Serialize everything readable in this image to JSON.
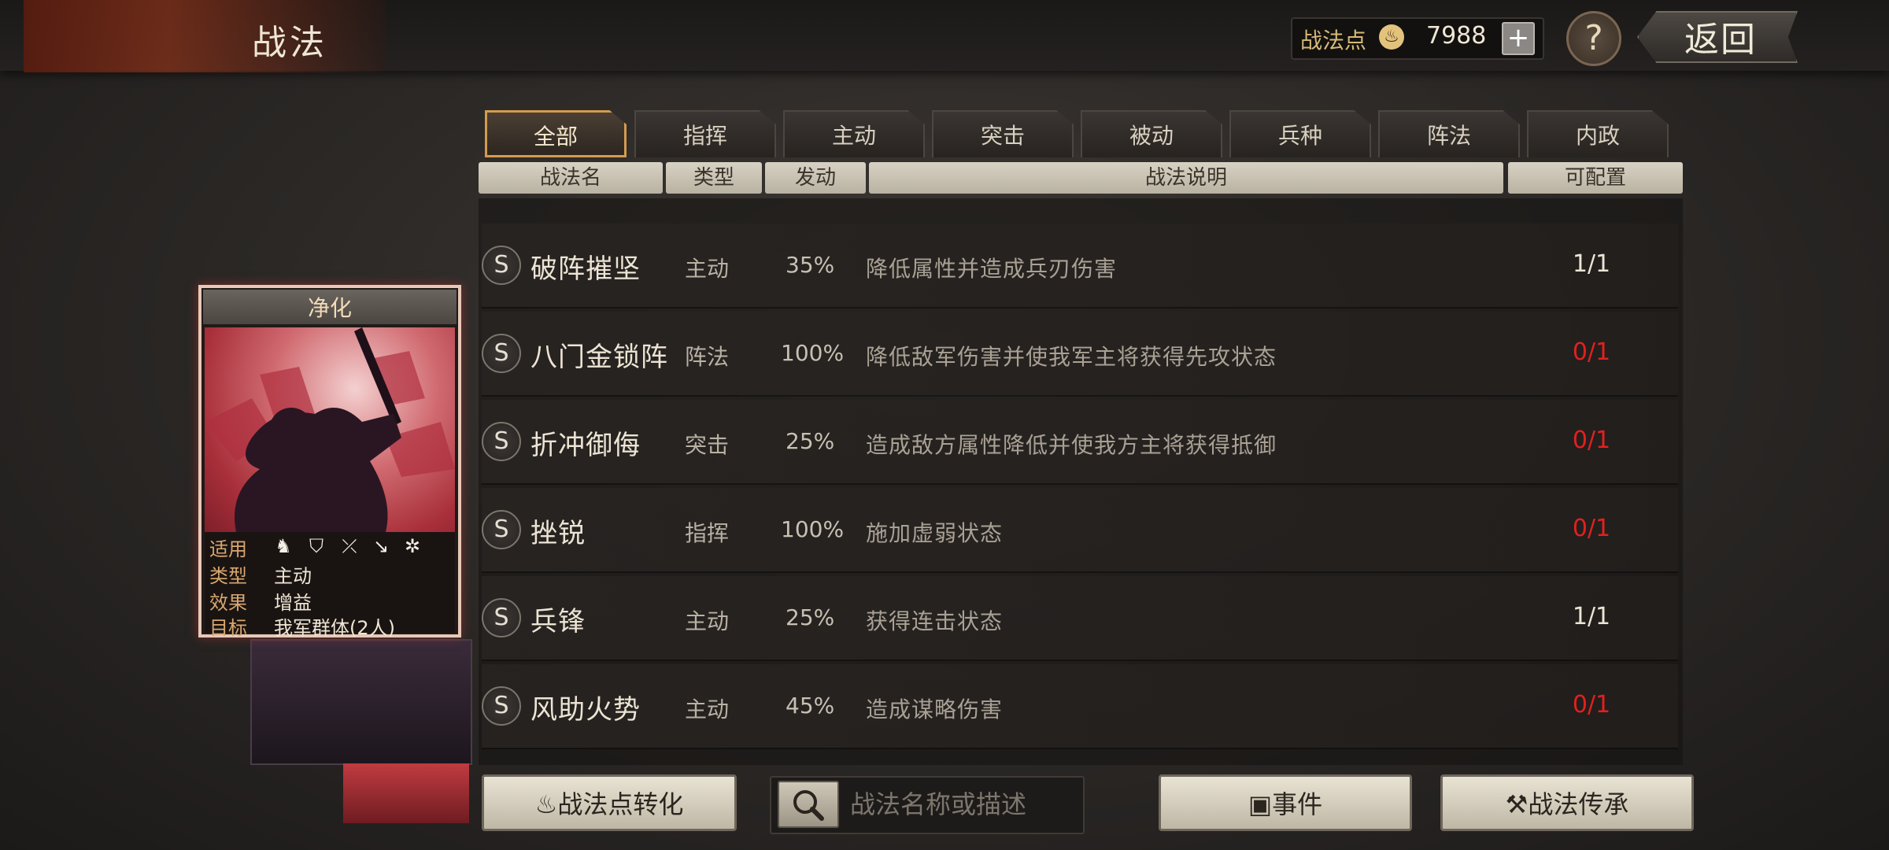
{
  "header": {
    "title": "战法",
    "points_label": "战法点",
    "points_value": "7988",
    "add_label": "+",
    "help_label": "?",
    "back_label": "返回"
  },
  "tabs": [
    "全部",
    "指挥",
    "主动",
    "突击",
    "被动",
    "兵种",
    "阵法",
    "内政"
  ],
  "active_tab": "全部",
  "columns": [
    "战法名",
    "类型",
    "发动",
    "战法说明",
    "可配置"
  ],
  "rows": [
    {
      "badge": "S",
      "name": "破阵摧坚",
      "type": "主动",
      "rate": "35%",
      "desc": "降低属性并造成兵刃伤害",
      "config": "1/1",
      "available": true
    },
    {
      "badge": "S",
      "name": "八门金锁阵",
      "type": "阵法",
      "rate": "100%",
      "desc": "降低敌军伤害并使我军主将获得先攻状态",
      "config": "0/1",
      "available": false
    },
    {
      "badge": "S",
      "name": "折冲御侮",
      "type": "突击",
      "rate": "25%",
      "desc": "造成敌方属性降低并使我方主将获得抵御",
      "config": "0/1",
      "available": false
    },
    {
      "badge": "S",
      "name": "挫锐",
      "type": "指挥",
      "rate": "100%",
      "desc": "施加虚弱状态",
      "config": "0/1",
      "available": false
    },
    {
      "badge": "S",
      "name": "兵锋",
      "type": "主动",
      "rate": "25%",
      "desc": "获得连击状态",
      "config": "1/1",
      "available": true
    },
    {
      "badge": "S",
      "name": "风助火势",
      "type": "主动",
      "rate": "45%",
      "desc": "造成谋略伤害",
      "config": "0/1",
      "available": false
    }
  ],
  "card": {
    "title": "净化",
    "apply_label": "适用",
    "type_label": "类型",
    "type_value": "主动",
    "effect_label": "效果",
    "effect_value": "增益",
    "target_label": "目标",
    "target_value": "我军群体(2人)",
    "unit_icons": [
      "cavalry-icon",
      "shield-icon",
      "bow-icon",
      "spear-icon",
      "wheel-icon"
    ]
  },
  "bottom": {
    "convert_label": "战法点转化",
    "search_placeholder": "战法名称或描述",
    "event_label": "事件",
    "inherit_label": "战法传承"
  },
  "colors": {
    "active_tab_border": "#d49b4f",
    "unavailable": "#e0211f",
    "gold": "#d7b978"
  }
}
